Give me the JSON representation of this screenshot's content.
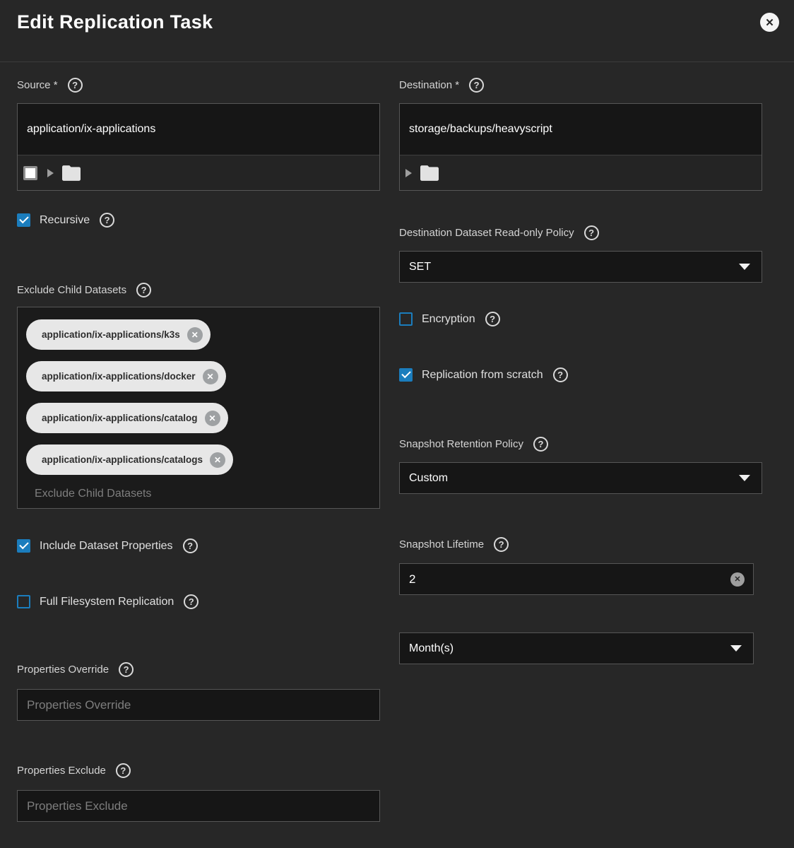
{
  "header": {
    "title": "Edit Replication Task"
  },
  "source": {
    "label": "Source *",
    "value": "application/ix-applications"
  },
  "destination": {
    "label": "Destination *",
    "value": "storage/backups/heavyscript"
  },
  "recursive": {
    "label": "Recursive",
    "checked": true
  },
  "readonly_policy": {
    "label": "Destination Dataset Read-only Policy",
    "value": "SET"
  },
  "exclude_child_datasets": {
    "label": "Exclude Child Datasets",
    "placeholder": "Exclude Child Datasets",
    "chips": [
      "application/ix-applications/k3s",
      "application/ix-applications/docker",
      "application/ix-applications/catalog",
      "application/ix-applications/catalogs"
    ]
  },
  "encryption": {
    "label": "Encryption",
    "checked": false
  },
  "replication_from_scratch": {
    "label": "Replication from scratch",
    "checked": true
  },
  "include_dataset_properties": {
    "label": "Include Dataset Properties",
    "checked": true
  },
  "snapshot_retention_policy": {
    "label": "Snapshot Retention Policy",
    "value": "Custom"
  },
  "full_filesystem_replication": {
    "label": "Full Filesystem Replication",
    "checked": false
  },
  "snapshot_lifetime": {
    "label": "Snapshot Lifetime",
    "value": "2"
  },
  "snapshot_lifetime_unit": {
    "value": "Month(s)"
  },
  "properties_override": {
    "label": "Properties Override",
    "placeholder": "Properties Override"
  },
  "properties_exclude": {
    "label": "Properties Exclude",
    "placeholder": "Properties Exclude"
  },
  "icons": {
    "close": "close-circle-icon",
    "help": "help-circle-icon",
    "folder": "folder-icon",
    "expand": "chevron-right-icon",
    "dropdown": "chevron-down-icon",
    "chip_remove": "remove-circle-icon",
    "clear": "clear-circle-icon"
  },
  "colors": {
    "background": "#272727",
    "field_background": "#161616",
    "border": "#565656",
    "accent_blue": "#1b7dbd",
    "chip_background": "#e7e7e7",
    "text_primary": "#ffffff",
    "text_label": "#d4d4d4",
    "text_placeholder": "#7e7e7e"
  }
}
